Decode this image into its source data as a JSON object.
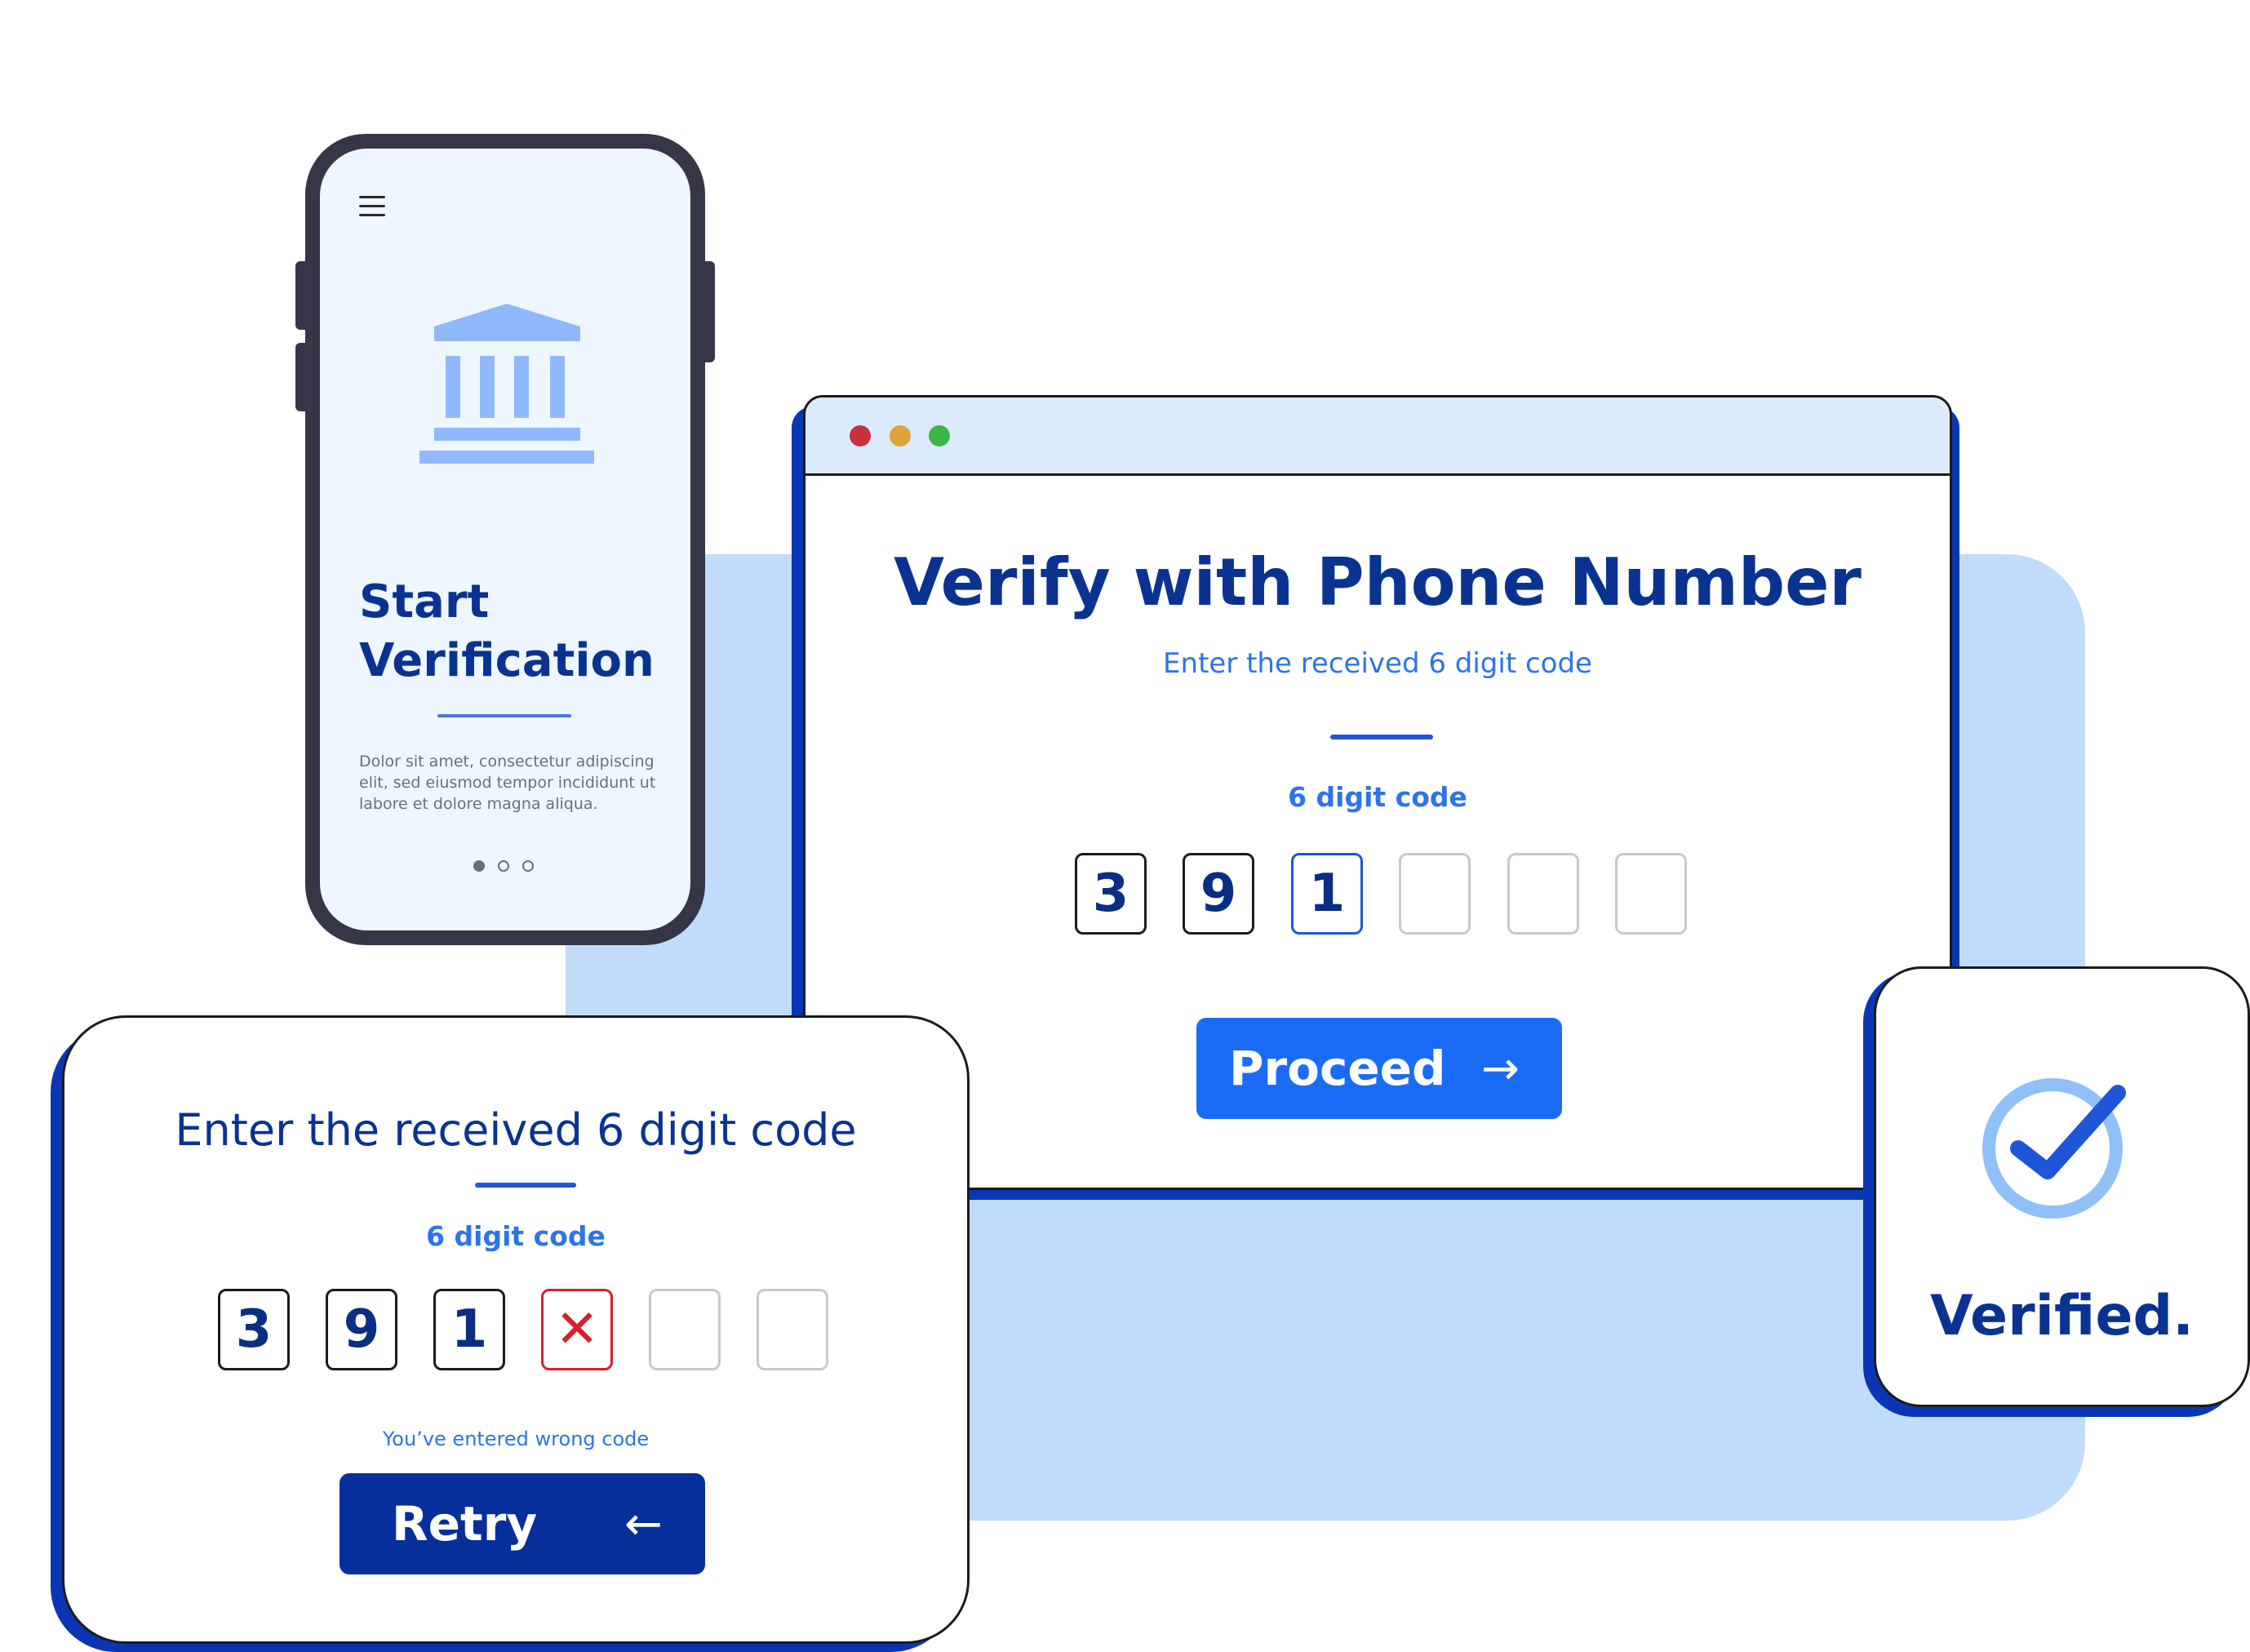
{
  "colors": {
    "navy": "#0a3391",
    "accent_blue": "#1a6cf6",
    "dark_blue_button": "#062f9c",
    "light_panel": "#c1dcfb",
    "error_red": "#d4212b"
  },
  "phone": {
    "menu_icon": "hamburger-menu-icon",
    "hero_icon": "bank-building-icon",
    "title_line1": "Start",
    "title_line2": "Verification",
    "body_line1": "Dolor sit amet, consectetur adipiscing",
    "body_line2": "elit, sed eiusmod tempor incididunt ut",
    "body_line3": "labore et dolore magna aliqua.",
    "pagination_active_index": 0
  },
  "browser": {
    "title": "Verify with Phone Number",
    "subtitle": "Enter the received 6 digit code",
    "code_label": "6 digit code",
    "code_digits": [
      "3",
      "9",
      "1",
      "",
      "",
      ""
    ],
    "proceed_label": "Proceed",
    "proceed_arrow": "→"
  },
  "retry_card": {
    "title": "Enter the received 6 digit code",
    "code_label": "6 digit code",
    "code_digits": [
      "3",
      "9",
      "1",
      "✕",
      "",
      ""
    ],
    "error_message": "You’ve entered wrong code",
    "retry_label": "Retry",
    "retry_arrow": "←"
  },
  "verified_card": {
    "icon": "check-circle-icon",
    "label": "Verified."
  }
}
